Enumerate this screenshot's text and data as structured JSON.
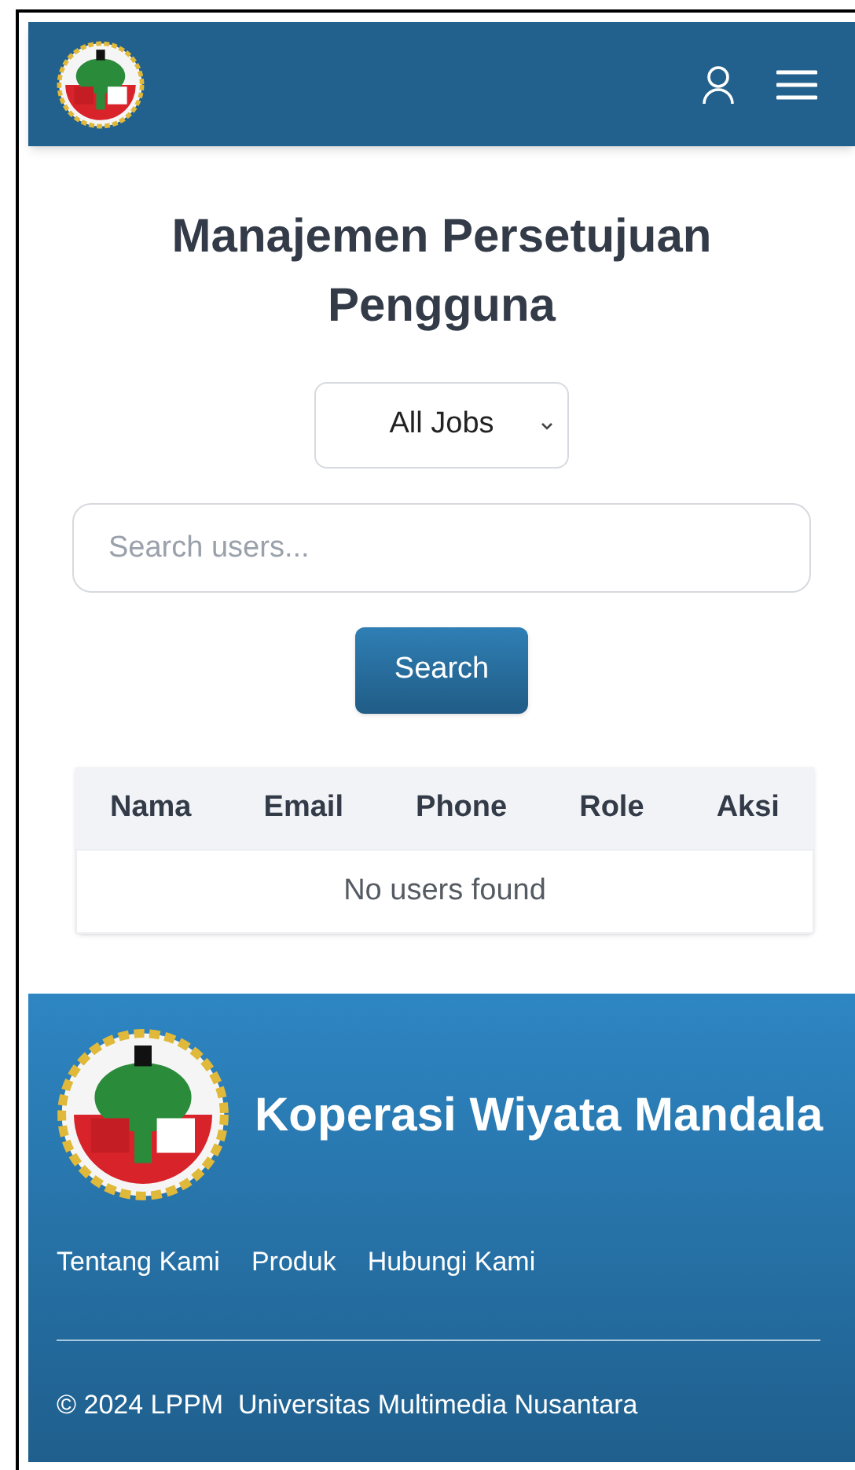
{
  "page": {
    "title": "Manajemen Persetujuan Pengguna"
  },
  "filter": {
    "value": "All Jobs"
  },
  "search": {
    "placeholder": "Search users...",
    "button": "Search"
  },
  "table": {
    "columns": [
      "Nama",
      "Email",
      "Phone",
      "Role",
      "Aksi"
    ],
    "empty_message": "No users found"
  },
  "footer": {
    "brand": "Koperasi Wiyata Mandala",
    "links": [
      "Tentang Kami",
      "Produk",
      "Hubungi Kami"
    ],
    "copyright": "© 2024 LPPM  Universitas Multimedia Nusantara"
  }
}
